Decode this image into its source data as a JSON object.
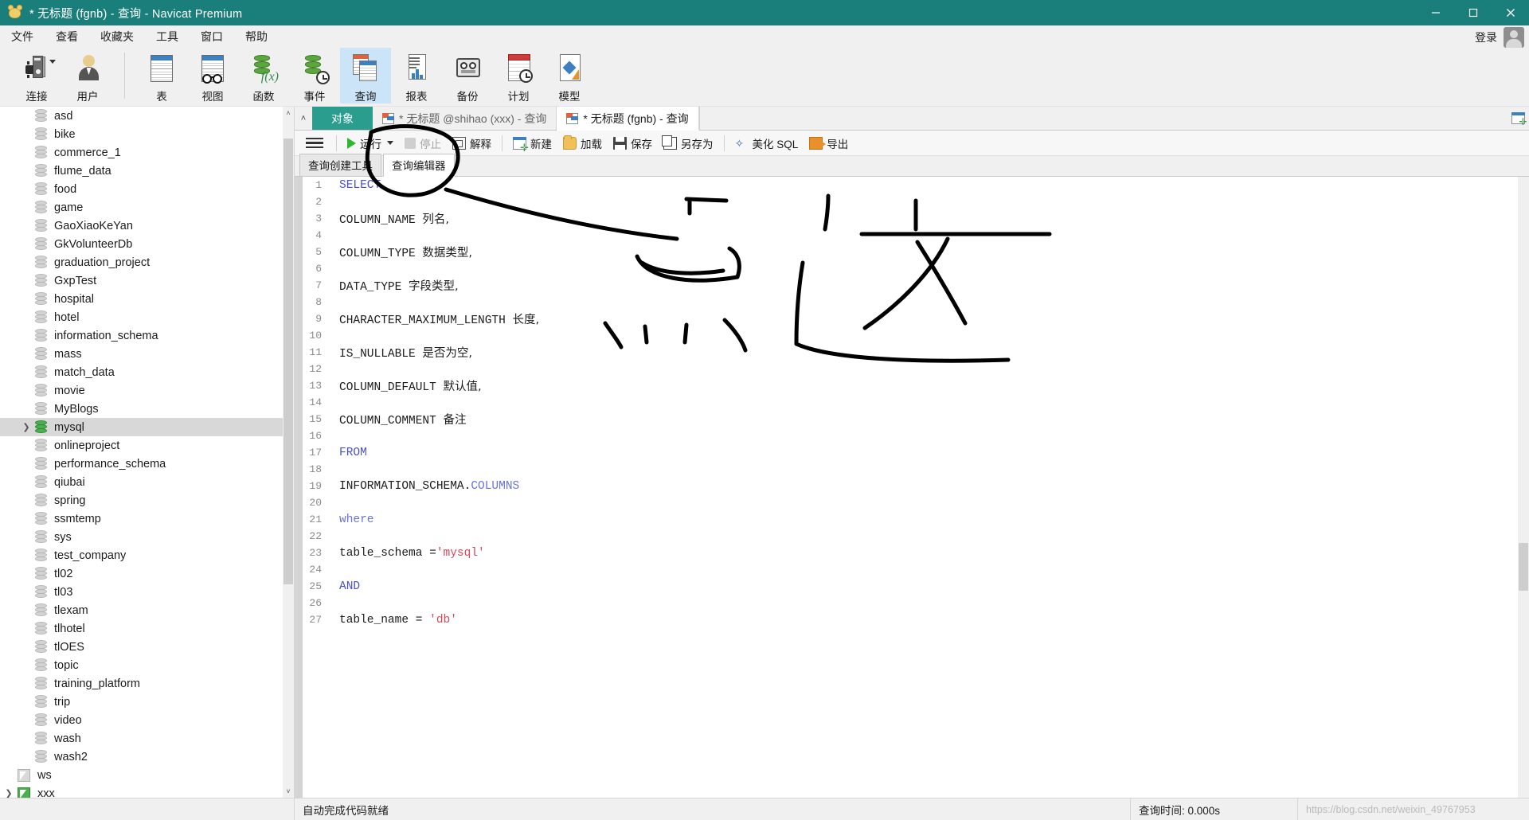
{
  "window": {
    "title": "* 无标题 (fgnb) - 查询 - Navicat Premium",
    "app_icon": "navicat-logo-icon",
    "minimize": "–",
    "maximize": "▢",
    "close": "✕",
    "titlebar_color": "#1a7f7a"
  },
  "menubar": {
    "items": [
      {
        "label": "文件",
        "name": "menu-file"
      },
      {
        "label": "查看",
        "name": "menu-view"
      },
      {
        "label": "收藏夹",
        "name": "menu-favorites"
      },
      {
        "label": "工具",
        "name": "menu-tools"
      },
      {
        "label": "窗口",
        "name": "menu-window"
      },
      {
        "label": "帮助",
        "name": "menu-help"
      }
    ],
    "login_label": "登录"
  },
  "toolbar": {
    "group1": [
      {
        "label": "连接",
        "icon": "connection-icon",
        "name": "toolbar-connection",
        "caret": true
      },
      {
        "label": "用户",
        "icon": "user-icon",
        "name": "toolbar-user",
        "caret": false
      }
    ],
    "group2": [
      {
        "label": "表",
        "icon": "table-icon",
        "name": "toolbar-table",
        "active": false
      },
      {
        "label": "视图",
        "icon": "view-icon",
        "name": "toolbar-view",
        "active": false
      },
      {
        "label": "函数",
        "icon": "function-icon",
        "name": "toolbar-function",
        "active": false
      },
      {
        "label": "事件",
        "icon": "event-icon",
        "name": "toolbar-event",
        "active": false
      },
      {
        "label": "查询",
        "icon": "query-icon",
        "name": "toolbar-query",
        "active": true
      },
      {
        "label": "报表",
        "icon": "report-icon",
        "name": "toolbar-report",
        "active": false
      },
      {
        "label": "备份",
        "icon": "backup-icon",
        "name": "toolbar-backup",
        "active": false
      },
      {
        "label": "计划",
        "icon": "schedule-icon",
        "name": "toolbar-schedule",
        "active": false
      },
      {
        "label": "模型",
        "icon": "model-icon",
        "name": "toolbar-model",
        "active": false
      }
    ]
  },
  "sidebar": {
    "scroll_up": "˄",
    "scroll_down": "˅",
    "items": [
      {
        "label": "asd",
        "icon": "schema-icon",
        "indent": 1,
        "expandable": false,
        "selected": false
      },
      {
        "label": "bike",
        "icon": "schema-icon",
        "indent": 1,
        "expandable": false,
        "selected": false
      },
      {
        "label": "commerce_1",
        "icon": "schema-icon",
        "indent": 1,
        "expandable": false,
        "selected": false
      },
      {
        "label": "flume_data",
        "icon": "schema-icon",
        "indent": 1,
        "expandable": false,
        "selected": false
      },
      {
        "label": "food",
        "icon": "schema-icon",
        "indent": 1,
        "expandable": false,
        "selected": false
      },
      {
        "label": "game",
        "icon": "schema-icon",
        "indent": 1,
        "expandable": false,
        "selected": false
      },
      {
        "label": "GaoXiaoKeYan",
        "icon": "schema-icon",
        "indent": 1,
        "expandable": false,
        "selected": false
      },
      {
        "label": "GkVolunteerDb",
        "icon": "schema-icon",
        "indent": 1,
        "expandable": false,
        "selected": false
      },
      {
        "label": "graduation_project",
        "icon": "schema-icon",
        "indent": 1,
        "expandable": false,
        "selected": false
      },
      {
        "label": "GxpTest",
        "icon": "schema-icon",
        "indent": 1,
        "expandable": false,
        "selected": false
      },
      {
        "label": "hospital",
        "icon": "schema-icon",
        "indent": 1,
        "expandable": false,
        "selected": false
      },
      {
        "label": "hotel",
        "icon": "schema-icon",
        "indent": 1,
        "expandable": false,
        "selected": false
      },
      {
        "label": "information_schema",
        "icon": "schema-icon",
        "indent": 1,
        "expandable": false,
        "selected": false
      },
      {
        "label": "mass",
        "icon": "schema-icon",
        "indent": 1,
        "expandable": false,
        "selected": false
      },
      {
        "label": "match_data",
        "icon": "schema-icon",
        "indent": 1,
        "expandable": false,
        "selected": false
      },
      {
        "label": "movie",
        "icon": "schema-icon",
        "indent": 1,
        "expandable": false,
        "selected": false
      },
      {
        "label": "MyBlogs",
        "icon": "schema-icon",
        "indent": 1,
        "expandable": false,
        "selected": false
      },
      {
        "label": "mysql",
        "icon": "schema-icon-green",
        "indent": 1,
        "expandable": true,
        "selected": true
      },
      {
        "label": "onlineproject",
        "icon": "schema-icon",
        "indent": 1,
        "expandable": false,
        "selected": false
      },
      {
        "label": "performance_schema",
        "icon": "schema-icon",
        "indent": 1,
        "expandable": false,
        "selected": false
      },
      {
        "label": "qiubai",
        "icon": "schema-icon",
        "indent": 1,
        "expandable": false,
        "selected": false
      },
      {
        "label": "spring",
        "icon": "schema-icon",
        "indent": 1,
        "expandable": false,
        "selected": false
      },
      {
        "label": "ssmtemp",
        "icon": "schema-icon",
        "indent": 1,
        "expandable": false,
        "selected": false
      },
      {
        "label": "sys",
        "icon": "schema-icon",
        "indent": 1,
        "expandable": false,
        "selected": false
      },
      {
        "label": "test_company",
        "icon": "schema-icon",
        "indent": 1,
        "expandable": false,
        "selected": false
      },
      {
        "label": "tl02",
        "icon": "schema-icon",
        "indent": 1,
        "expandable": false,
        "selected": false
      },
      {
        "label": "tl03",
        "icon": "schema-icon",
        "indent": 1,
        "expandable": false,
        "selected": false
      },
      {
        "label": "tlexam",
        "icon": "schema-icon",
        "indent": 1,
        "expandable": false,
        "selected": false
      },
      {
        "label": "tlhotel",
        "icon": "schema-icon",
        "indent": 1,
        "expandable": false,
        "selected": false
      },
      {
        "label": "tlOES",
        "icon": "schema-icon",
        "indent": 1,
        "expandable": false,
        "selected": false
      },
      {
        "label": "topic",
        "icon": "schema-icon",
        "indent": 1,
        "expandable": false,
        "selected": false
      },
      {
        "label": "training_platform",
        "icon": "schema-icon",
        "indent": 1,
        "expandable": false,
        "selected": false
      },
      {
        "label": "trip",
        "icon": "schema-icon",
        "indent": 1,
        "expandable": false,
        "selected": false
      },
      {
        "label": "video",
        "icon": "schema-icon",
        "indent": 1,
        "expandable": false,
        "selected": false
      },
      {
        "label": "wash",
        "icon": "schema-icon",
        "indent": 1,
        "expandable": false,
        "selected": false
      },
      {
        "label": "wash2",
        "icon": "schema-icon",
        "indent": 1,
        "expandable": false,
        "selected": false
      },
      {
        "label": "ws",
        "icon": "connection-tree-icon",
        "indent": 0,
        "expandable": false,
        "selected": false
      },
      {
        "label": "xxx",
        "icon": "connection-tree-icon-green",
        "indent": 0,
        "expandable": true,
        "selected": false
      }
    ]
  },
  "tabs": {
    "collapse_caret": "˄",
    "items": [
      {
        "label": "对象",
        "style": "objects",
        "active": false,
        "icon": null
      },
      {
        "label": "* 无标题 @shihao (xxx) - 查询",
        "style": "query",
        "active": false,
        "icon": "query-tab-icon"
      },
      {
        "label": "* 无标题 (fgnb) - 查询",
        "style": "query",
        "active": true,
        "icon": "query-tab-icon"
      }
    ],
    "new_tab_icon": "new-query-tab-icon"
  },
  "query_toolbar": {
    "menu_icon": "hamburger-menu-icon",
    "buttons": [
      {
        "label": "运行",
        "icon": "run-icon",
        "name": "run-button",
        "disabled": false,
        "caret": true
      },
      {
        "label": "停止",
        "icon": "stop-icon",
        "name": "stop-button",
        "disabled": true,
        "caret": false
      },
      {
        "label": "解释",
        "icon": "explain-icon",
        "name": "explain-button",
        "disabled": false,
        "caret": false
      },
      {
        "label": "新建",
        "icon": "new-icon",
        "name": "new-button",
        "disabled": false,
        "caret": false
      },
      {
        "label": "加载",
        "icon": "load-icon",
        "name": "load-button",
        "disabled": false,
        "caret": false
      },
      {
        "label": "保存",
        "icon": "save-icon",
        "name": "save-button",
        "disabled": false,
        "caret": false
      },
      {
        "label": "另存为",
        "icon": "save-as-icon",
        "name": "save-as-button",
        "disabled": false,
        "caret": false
      },
      {
        "label": "美化 SQL",
        "icon": "beautify-icon",
        "name": "beautify-sql-button",
        "disabled": false,
        "caret": false
      },
      {
        "label": "导出",
        "icon": "export-icon",
        "name": "export-button",
        "disabled": false,
        "caret": false
      }
    ]
  },
  "subtabs": [
    {
      "label": "查询创建工具",
      "active": false,
      "name": "tab-query-builder"
    },
    {
      "label": "查询编辑器",
      "active": true,
      "name": "tab-query-editor"
    }
  ],
  "editor": {
    "lines": [
      {
        "n": 1,
        "tokens": [
          {
            "t": "SELECT",
            "c": "kw"
          }
        ]
      },
      {
        "n": 2,
        "tokens": []
      },
      {
        "n": 3,
        "tokens": [
          {
            "t": "COLUMN_NAME ",
            "c": ""
          },
          {
            "t": "列名,",
            "c": "zh"
          }
        ]
      },
      {
        "n": 4,
        "tokens": []
      },
      {
        "n": 5,
        "tokens": [
          {
            "t": "COLUMN_TYPE ",
            "c": ""
          },
          {
            "t": "数据类型,",
            "c": "zh"
          }
        ]
      },
      {
        "n": 6,
        "tokens": []
      },
      {
        "n": 7,
        "tokens": [
          {
            "t": "DATA_TYPE ",
            "c": ""
          },
          {
            "t": "字段类型,",
            "c": "zh"
          }
        ]
      },
      {
        "n": 8,
        "tokens": []
      },
      {
        "n": 9,
        "tokens": [
          {
            "t": "CHARACTER_MAXIMUM_LENGTH ",
            "c": ""
          },
          {
            "t": "长度,",
            "c": "zh"
          }
        ]
      },
      {
        "n": 10,
        "tokens": []
      },
      {
        "n": 11,
        "tokens": [
          {
            "t": "IS_NULLABLE ",
            "c": ""
          },
          {
            "t": "是否为空,",
            "c": "zh"
          }
        ]
      },
      {
        "n": 12,
        "tokens": []
      },
      {
        "n": 13,
        "tokens": [
          {
            "t": "COLUMN_DEFAULT ",
            "c": ""
          },
          {
            "t": "默认值,",
            "c": "zh"
          }
        ]
      },
      {
        "n": 14,
        "tokens": []
      },
      {
        "n": 15,
        "tokens": [
          {
            "t": "COLUMN_COMMENT ",
            "c": ""
          },
          {
            "t": "备注",
            "c": "zh"
          }
        ]
      },
      {
        "n": 16,
        "tokens": []
      },
      {
        "n": 17,
        "tokens": [
          {
            "t": "FROM",
            "c": "kw"
          }
        ]
      },
      {
        "n": 18,
        "tokens": []
      },
      {
        "n": 19,
        "tokens": [
          {
            "t": "INFORMATION_SCHEMA.",
            "c": ""
          },
          {
            "t": "COLUMNS",
            "c": "kw2"
          }
        ]
      },
      {
        "n": 20,
        "tokens": []
      },
      {
        "n": 21,
        "tokens": [
          {
            "t": "where",
            "c": "kw2"
          }
        ]
      },
      {
        "n": 22,
        "tokens": []
      },
      {
        "n": 23,
        "tokens": [
          {
            "t": "table_schema =",
            "c": ""
          },
          {
            "t": "'mysql'",
            "c": "str"
          }
        ]
      },
      {
        "n": 24,
        "tokens": []
      },
      {
        "n": 25,
        "tokens": [
          {
            "t": "AND",
            "c": "kw"
          }
        ]
      },
      {
        "n": 26,
        "tokens": []
      },
      {
        "n": 27,
        "tokens": [
          {
            "t": "table_name = ",
            "c": ""
          },
          {
            "t": "'db'",
            "c": "str"
          }
        ]
      }
    ]
  },
  "statusbar": {
    "left": "",
    "center": "自动完成代码就绪",
    "right": "查询时间: 0.000s",
    "watermark": "https://blog.csdn.net/weixin_49767953"
  }
}
